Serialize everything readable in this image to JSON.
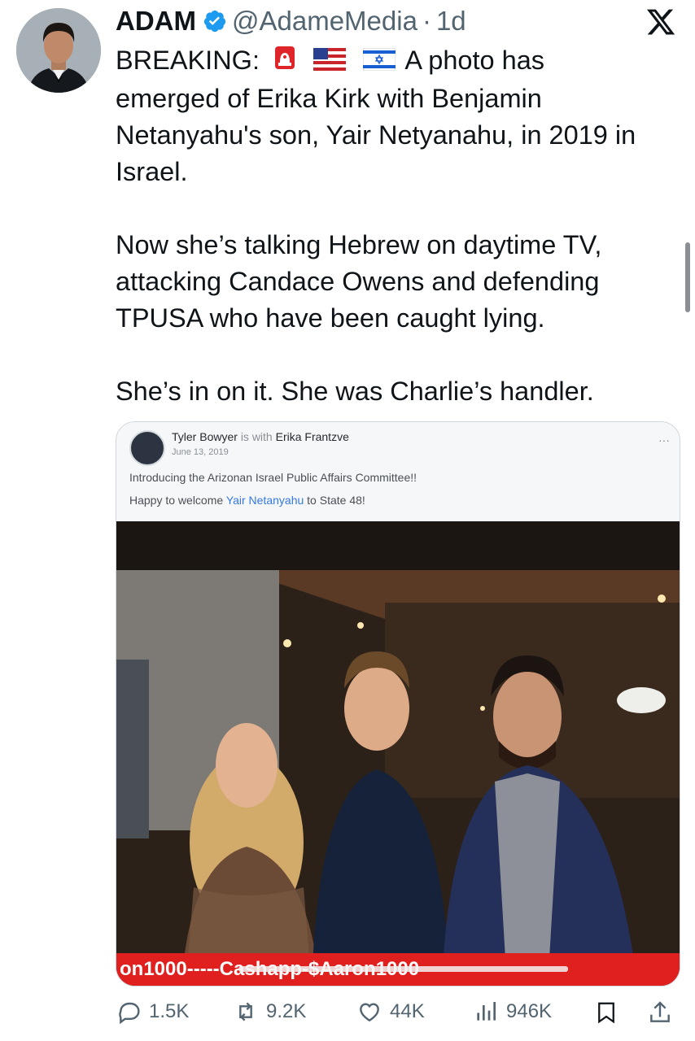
{
  "author": {
    "display_name": "ADAM",
    "handle": "@AdameMedia",
    "separator": "·",
    "timestamp": "1d"
  },
  "tweet": {
    "lines": [
      "emerged of Erika Kirk with Benjamin",
      "Netanyahu's son, Yair Netyanahu, in 2019 in",
      "Israel."
    ],
    "breaking_label": "BREAKING:",
    "headline_tail": "A photo has",
    "paragraph2": [
      "Now she’s talking Hebrew on daytime TV,",
      "attacking Candace Owens and defending",
      "TPUSA who have been caught lying."
    ],
    "paragraph3": "She’s in on it. She was Charlie’s handler.",
    "emojis": [
      "siren-emoji",
      "us-flag-emoji",
      "israel-flag-emoji"
    ]
  },
  "media": {
    "post_author": "Tyler Bowyer",
    "post_with": "is with",
    "post_tagged": "Erika Frantzve",
    "post_date": "June 13, 2019",
    "post_line1": "Introducing the Arizonan Israel Public Affairs Committee!!",
    "post_line2_pre": "Happy to welcome",
    "post_line2_link": "Yair Netanyahu",
    "post_line2_post": "to State 48!",
    "more": "···",
    "ticker_text": "on1000-----Cashapp-$Aaron1000"
  },
  "actions": {
    "replies": "1.5K",
    "reposts": "9.2K",
    "likes": "44K",
    "views": "946K"
  },
  "colors": {
    "verified_blue": "#1d9bf0",
    "muted_text": "#536471",
    "ticker_red": "#e0201f"
  }
}
